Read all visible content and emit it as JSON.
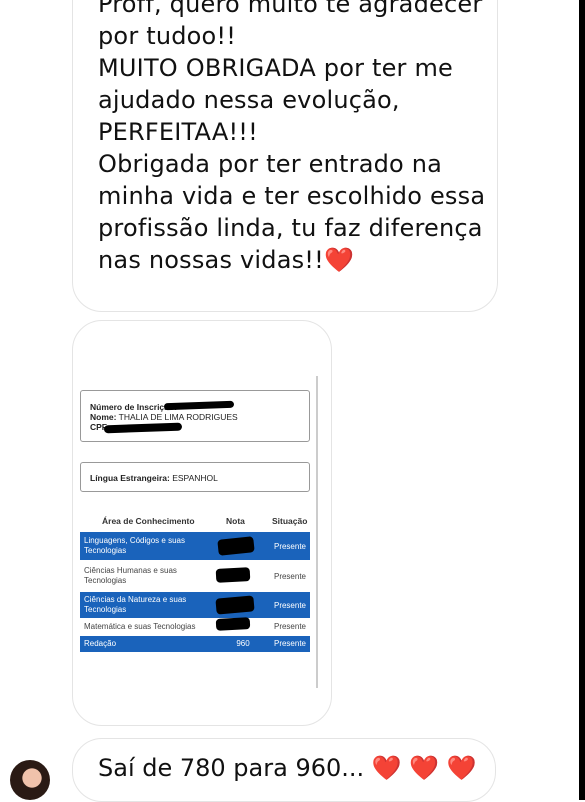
{
  "message1": {
    "lines": [
      "Proff, quero muito te agradecer",
      "por tudoo!!",
      "MUITO OBRIGADA por ter me",
      "ajudado nessa evolução,",
      "PERFEITAA!!!",
      "Obrigada por ter entrado na",
      "minha vida e ter escolhido essa",
      "profissão linda, tu faz diferença",
      "nas nossas vidas!!"
    ],
    "emoji": "❤️"
  },
  "document": {
    "inscricao_label": "Número de Inscrição:",
    "nome_label": "Nome:",
    "nome_value": "THALIA DE LIMA RODRIGUES",
    "cpf_label": "CPF:",
    "lingua_label": "Língua Estrangeira:",
    "lingua_value": "ESPANHOL",
    "headers": {
      "area": "Área de Conhecimento",
      "nota": "Nota",
      "situacao": "Situação"
    },
    "rows": [
      {
        "area": [
          "Linguagens, Códigos e suas",
          "Tecnologias"
        ],
        "nota": "",
        "situacao": "Presente",
        "redacted": true
      },
      {
        "area": [
          "Ciências Humanas e suas",
          "Tecnologias"
        ],
        "nota": "",
        "situacao": "Presente",
        "redacted": true
      },
      {
        "area": [
          "Ciências da Natureza e suas",
          "Tecnologias"
        ],
        "nota": "",
        "situacao": "Presente",
        "redacted": true
      },
      {
        "area": [
          "Matemática e suas Tecnologias"
        ],
        "nota": "",
        "situacao": "Presente",
        "redacted": true
      },
      {
        "area": [
          "Redação"
        ],
        "nota": "960",
        "situacao": "Presente",
        "redacted": false
      }
    ]
  },
  "message2": {
    "text": "Saí de 780 para 960...",
    "emoji": "❤️ ❤️ ❤️"
  },
  "colors": {
    "table_blue": "#1a63bb",
    "heart": "#e0242e",
    "bubble_border": "#e4e4e4"
  }
}
